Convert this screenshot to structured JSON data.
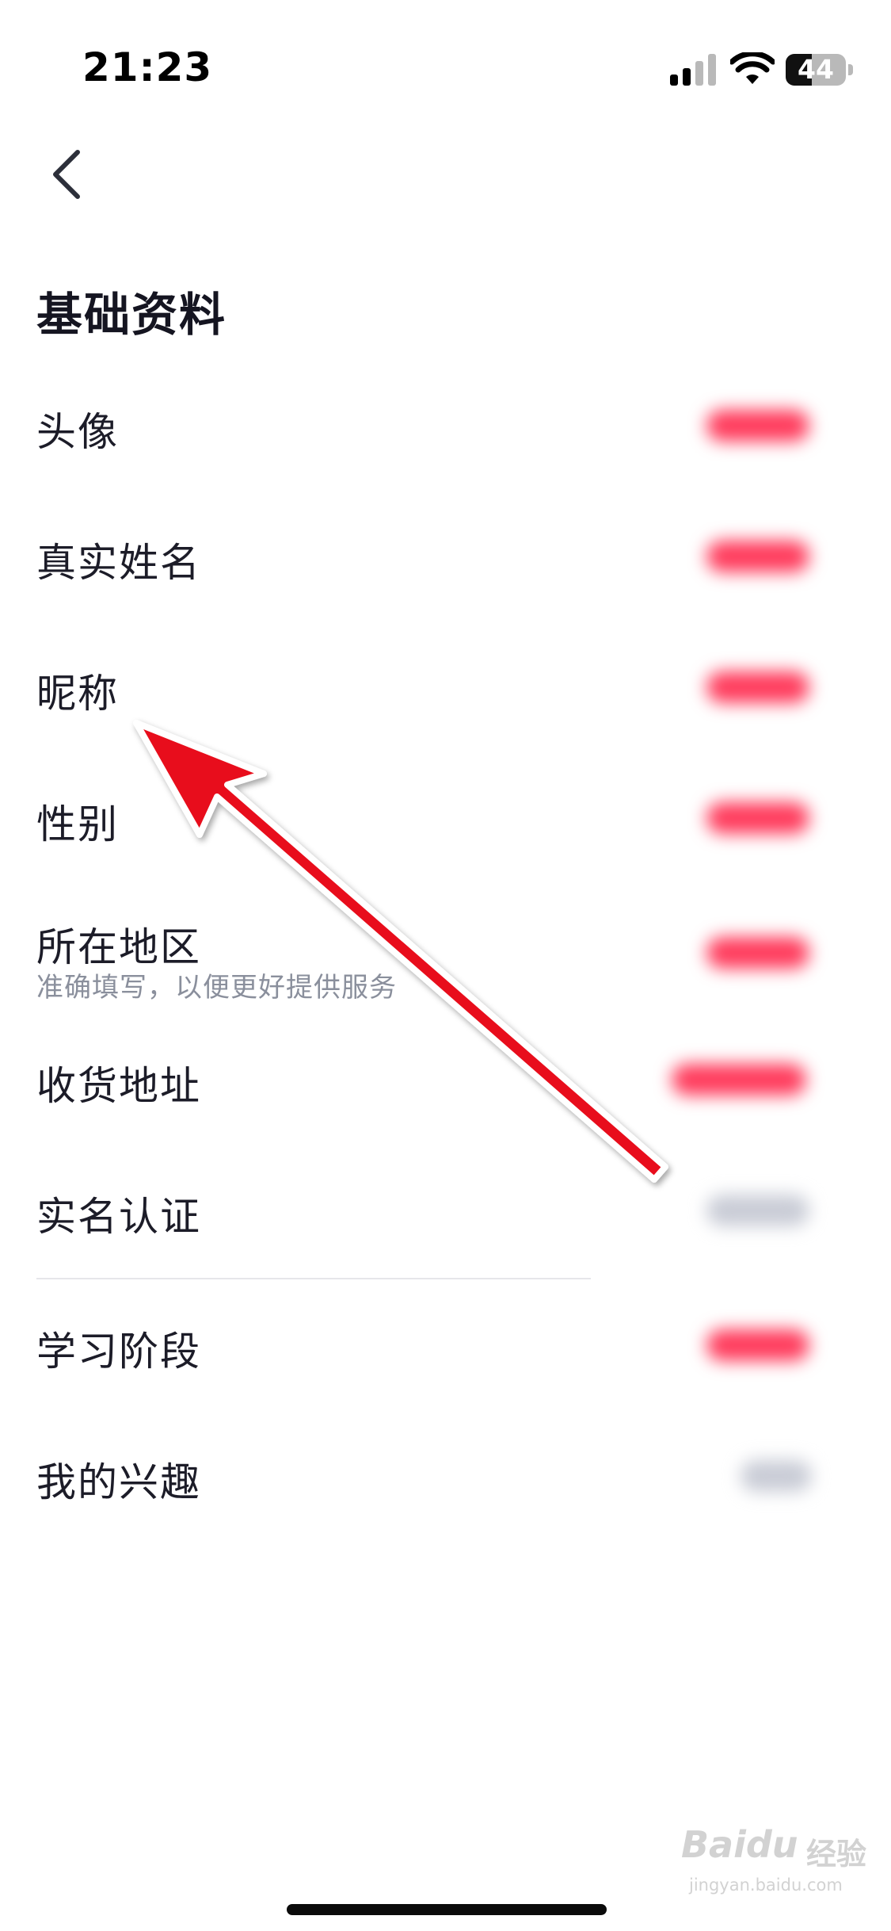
{
  "status_bar": {
    "time": "21:23",
    "battery_level": "44",
    "signal_icon": "cellular-signal-icon",
    "wifi_icon": "wifi-icon"
  },
  "nav": {
    "back_icon": "chevron-left-icon"
  },
  "page_title": "基础资料",
  "rows": [
    {
      "label": "头像",
      "value_state": "blurred",
      "value_color": "#ff3b5c"
    },
    {
      "label": "真实姓名",
      "value_state": "blurred",
      "value_color": "#ff3b5c"
    },
    {
      "label": "昵称",
      "value_state": "blurred",
      "value_color": "#ff3b5c"
    },
    {
      "label": "性别",
      "value_state": "blurred",
      "value_color": "#ff3b5c"
    },
    {
      "label": "所在地区",
      "sublabel": "准确填写，以便更好提供服务",
      "value_state": "blurred",
      "value_color": "#ff3b5c"
    },
    {
      "label": "收货地址",
      "value_state": "blurred",
      "value_color": "#ff3b5c"
    },
    {
      "label": "实名认证",
      "value_state": "blurred",
      "value_color": "#c9ccd6"
    },
    {
      "label": "学习阶段",
      "value_state": "blurred",
      "value_color": "#ff3b5c"
    },
    {
      "label": "我的兴趣",
      "value_state": "blurred",
      "value_color": "#c9ccd6"
    }
  ],
  "annotation": {
    "type": "red-arrow",
    "points_to": "昵称",
    "color": "#e8101a"
  },
  "watermark": {
    "logo_text": "Baidu",
    "cn_text": "经验",
    "url": "jingyan.baidu.com"
  }
}
